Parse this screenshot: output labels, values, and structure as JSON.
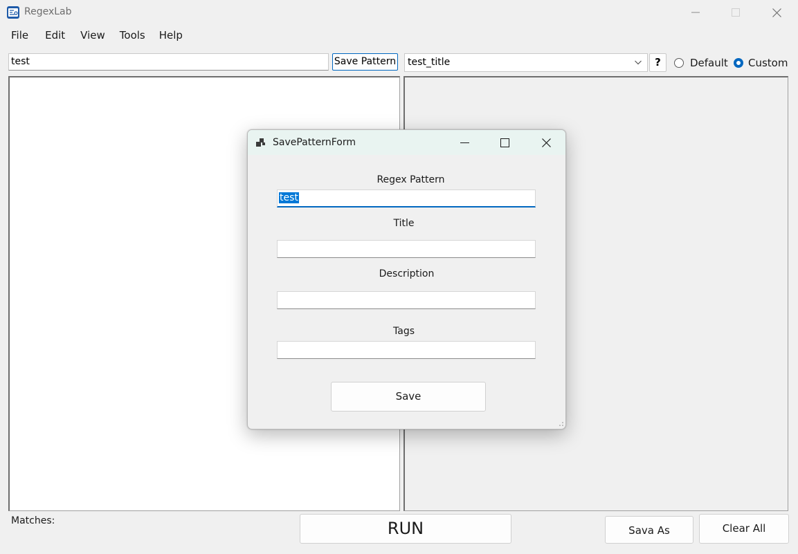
{
  "window": {
    "title": "RegexLab"
  },
  "menu": {
    "items": [
      "File",
      "Edit",
      "View",
      "Tools",
      "Help"
    ]
  },
  "toolbar": {
    "pattern_value": "test",
    "save_pattern_label": "Save Pattern",
    "title_select_value": "test_title",
    "help_label": "?",
    "radio_default_label": "Default",
    "radio_custom_label": "Custom",
    "radio_selected": "Custom"
  },
  "bottom": {
    "matches_label": "Matches:",
    "run_label": "RUN",
    "save_as_label": "Sava As",
    "clear_all_label": "Clear All"
  },
  "dialog": {
    "title": "SavePatternForm",
    "regex_label": "Regex Pattern",
    "regex_value": "test",
    "title_label": "Title",
    "title_value": "",
    "description_label": "Description",
    "description_value": "",
    "tags_label": "Tags",
    "tags_value": "",
    "save_label": "Save"
  },
  "colors": {
    "accent": "#0067c0",
    "selection": "#0078d7",
    "dialog_titlebar": "#e9f4f1"
  }
}
